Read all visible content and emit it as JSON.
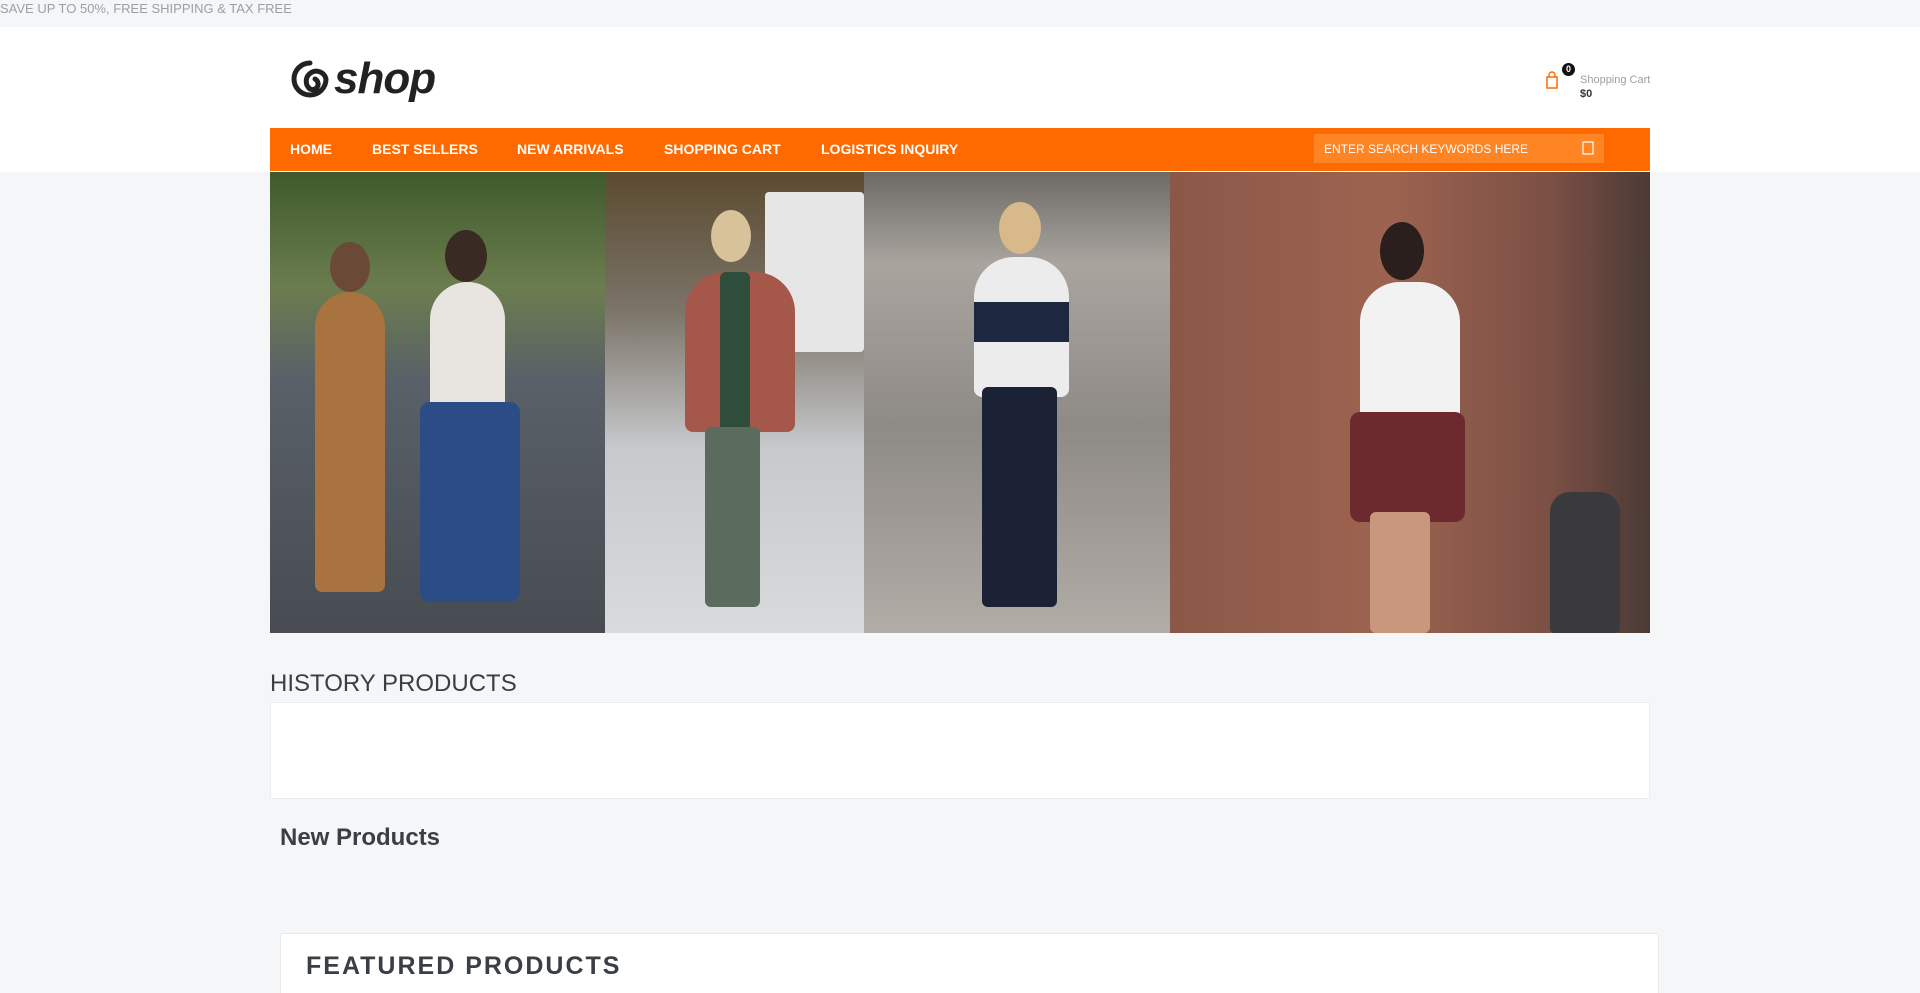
{
  "topbar": {
    "promo": "SAVE UP TO 50%, FREE SHIPPING & TAX FREE"
  },
  "header": {
    "logo_text": "shop",
    "logo_icon": "swirl-logo-icon",
    "cart": {
      "count": "0",
      "label": "Shopping Cart",
      "total": "$0",
      "icon": "shopping-bag-icon"
    }
  },
  "nav": {
    "items": [
      {
        "label": "HOME"
      },
      {
        "label": "BEST SELLERS"
      },
      {
        "label": "NEW ARRIVALS"
      },
      {
        "label": "SHOPPING CART"
      },
      {
        "label": "LOGISTICS INQUIRY"
      }
    ],
    "search": {
      "placeholder": "ENTER SEARCH KEYWORDS HERE",
      "icon": "search-icon"
    }
  },
  "sections": {
    "history": "HISTORY PRODUCTS",
    "new_products": "New Products",
    "featured": "FEATURED PRODUCTS"
  },
  "colors": {
    "accent": "#ff6a00",
    "search_bg": "#ff8424",
    "page_bg": "#f4f6f8"
  }
}
